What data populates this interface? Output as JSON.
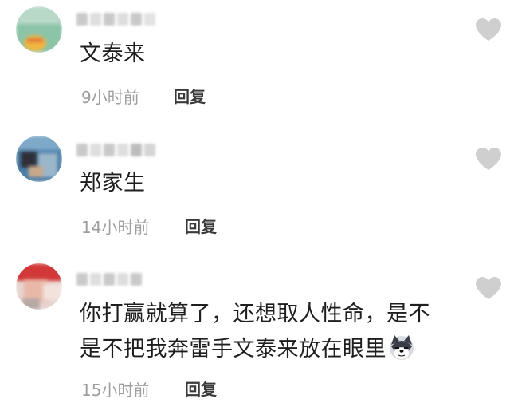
{
  "comments": [
    {
      "text": "文泰来",
      "time": "9小时前",
      "reply_label": "回复",
      "avatar_color": "#7fb59a"
    },
    {
      "text": "郑家生",
      "time": "14小时前",
      "reply_label": "回复",
      "avatar_color": "#3a6f9a"
    },
    {
      "text_line1": "你打赢就算了，还想取人性命，是不",
      "text_line2": "是不把我奔雷手文泰来放在眼里",
      "emoji": "doge-emoji",
      "time": "15小时前",
      "reply_label": "回复",
      "avatar_color": "#c63a3a"
    }
  ],
  "colors": {
    "heart": "#cfcfcf",
    "meta_text": "#9e9e9e"
  },
  "icons": [
    "heart-icon",
    "doge-emoji"
  ]
}
